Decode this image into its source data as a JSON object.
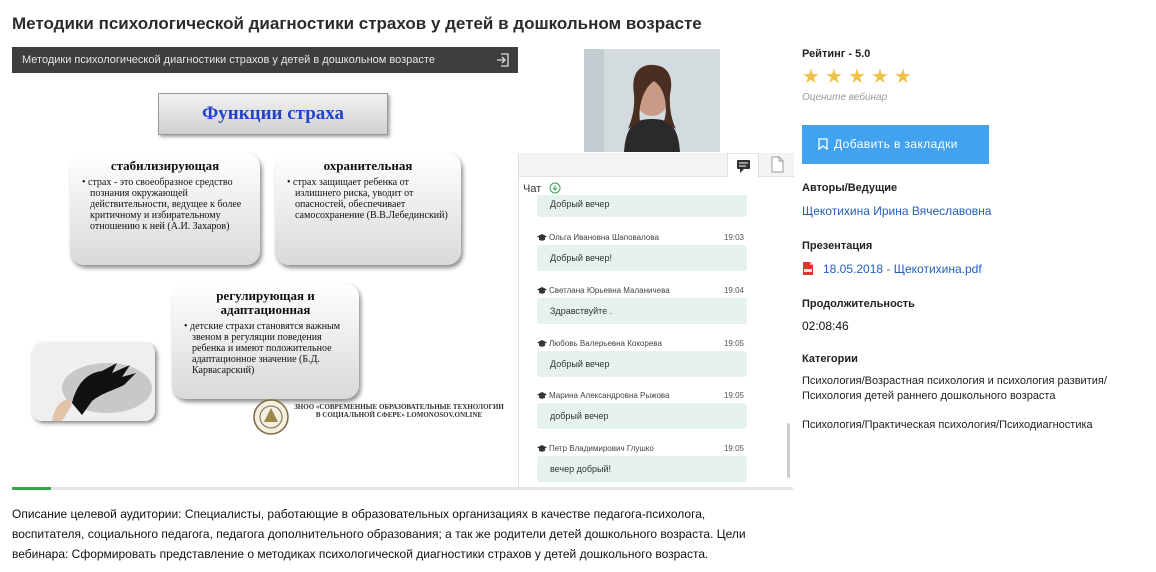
{
  "page": {
    "title": "Методики психологической диагностики страхов у детей в дошкольном возрасте"
  },
  "player": {
    "slide_bar_title": "Методики психологической диагностики страхов у детей в дошкольном возрасте",
    "slide": {
      "heading": "Функции страха",
      "boxes": [
        {
          "title": "стабилизирующая",
          "text": "• страх - это своеобразное средство познания окружающей действительности, ведущее к более критичному и избирательному отношению к ней (А.И. Захаров)"
        },
        {
          "title": "охранительная",
          "text": "• страх защищает ребенка от излишнего риска, уводит от опасностей, обеспечивает самосохранение (В.В.Лебединский)"
        },
        {
          "title": "регулирующая и адаптационная",
          "text": "• детские страхи становятся важным звеном в регуляции поведения ребенка и имеют положительное адаптационное значение (Б.Д. Карвасарский)"
        }
      ],
      "org_text": "ЗНОО «СОВРЕМЕННЫЕ ОБРАЗОВАТЕЛЬНЫЕ ТЕХНОЛОГИИ В СОЦИАЛЬНОЙ СФЕРЕ» LOMONOSOV.ONLINE"
    },
    "progress_fraction": 0.05
  },
  "chat": {
    "label": "Чат",
    "messages": [
      {
        "author": "",
        "time": "",
        "text": "Добрый вечер"
      },
      {
        "author": "Ольга Ивановна Шаповалова",
        "time": "19:03",
        "text": "Добрый вечер!"
      },
      {
        "author": "Светлана Юрьевна Маланичева",
        "time": "19:04",
        "text": "Здравствуйте ."
      },
      {
        "author": "Любовь Валерьевна Кокорева",
        "time": "19:05",
        "text": "Добрый вечер"
      },
      {
        "author": "Марина Александровна Рыжова",
        "time": "19:05",
        "text": "добрый вечер"
      },
      {
        "author": "Петр Владимирович Глушко",
        "time": "19:05",
        "text": "вечер добрый!"
      }
    ]
  },
  "description": "Описание целевой аудитории: Специалисты, работающие в образовательных организациях в качестве педагога-психолога, воспитателя, социального педагога, педагога дополнительного образования; а так же родители детей дошкольного возраста. Цели вебинара: Сформировать представление о методиках психологической диагностики страхов у детей дошкольного возраста.",
  "sidebar": {
    "rating_label": "Рейтинг - 5.0",
    "stars": 5,
    "star_glyph": "★",
    "star_color": "#f0c24a",
    "rate_hint": "Оцените вебинар",
    "bookmark_label": "Добавить в закладки",
    "bookmark_color": "#41a3ef",
    "authors_label": "Авторы/Ведущие",
    "author": "Щекотихина Ирина Вячеславовна",
    "presentation_label": "Презентация",
    "presentation_file": "18.05.2018 - Щекотихина.pdf",
    "duration_label": "Продолжительность",
    "duration": "02:08:46",
    "categories_label": "Категории",
    "categories": [
      "Психология/Возрастная психология и психология развития/Психология детей раннего дошкольного возраста",
      "Психология/Практическая психология/Психодиагностика"
    ]
  }
}
